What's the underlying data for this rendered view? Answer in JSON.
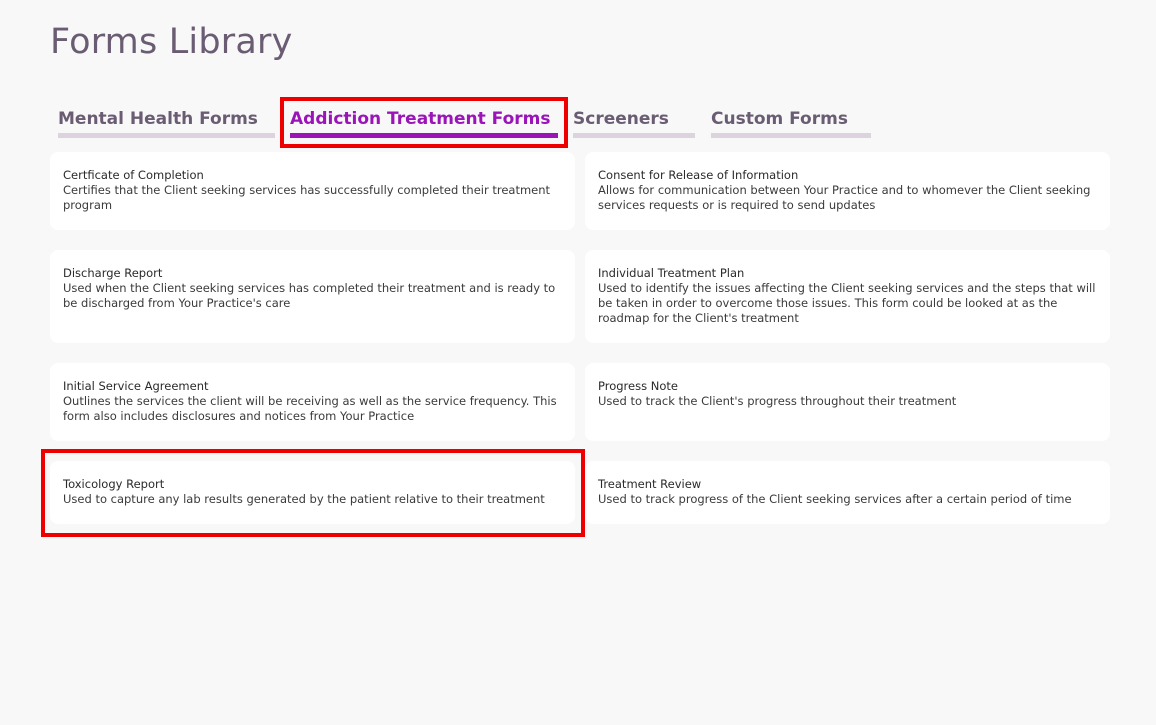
{
  "header": {
    "title": "Forms Library"
  },
  "tabs": [
    {
      "label": "Mental Health Forms",
      "active": false
    },
    {
      "label": "Addiction Treatment Forms",
      "active": true
    },
    {
      "label": "Screeners",
      "active": false
    },
    {
      "label": "Custom Forms",
      "active": false
    }
  ],
  "forms": [
    {
      "title": "Certficate of Completion",
      "description": "Certifies that the Client seeking services has successfully completed their treatment program"
    },
    {
      "title": "Consent for Release of Information",
      "description": "Allows for communication between Your Practice and to whomever the Client seeking services requests or is required to send updates"
    },
    {
      "title": "Discharge Report",
      "description": "Used when the Client seeking services has completed their treatment and is ready to be discharged from Your Practice's care"
    },
    {
      "title": "Individual Treatment Plan",
      "description": "Used to identify the issues affecting the Client seeking services and the steps that will be taken in order to overcome those issues. This form could be looked at as the roadmap for the Client's treatment"
    },
    {
      "title": "Initial Service Agreement",
      "description": "Outlines the services the client will be receiving as well as the service frequency. This form also includes disclosures and notices from Your Practice"
    },
    {
      "title": "Progress Note",
      "description": "Used to track the Client's progress throughout their treatment"
    },
    {
      "title": "Toxicology Report",
      "description": "Used to capture any lab results generated by the patient relative to their treatment"
    },
    {
      "title": "Treatment Review",
      "description": "Used to track progress of the Client seeking services after a certain period of time"
    }
  ],
  "colors": {
    "accent": "#9a14b8",
    "title": "#6a5c72",
    "highlight": "#ee0000",
    "background": "#f8f8f8"
  }
}
